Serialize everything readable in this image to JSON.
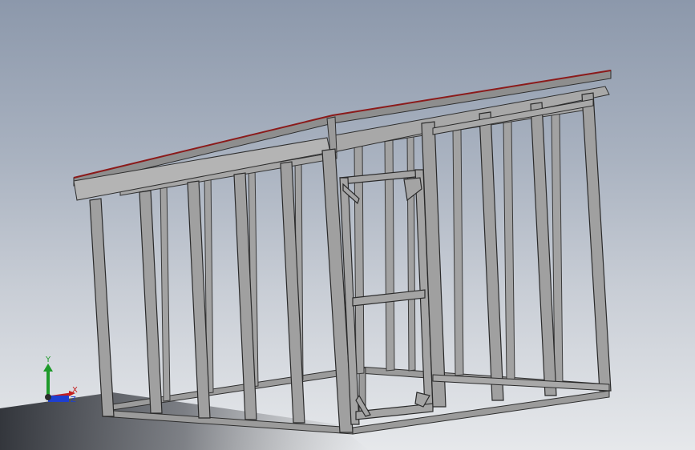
{
  "viewport": {
    "background_top": "#8c98ab",
    "background_bottom": "#e6e8eb"
  },
  "model": {
    "frame_color": "#9a9a9a",
    "frame_edge_color": "#3a3a3a",
    "roof_color": "#8f8f8f",
    "roof_edge_color": "#8b1a1a"
  },
  "triad": {
    "y_label": "Y",
    "x_label": "X",
    "z_label": "Z",
    "y_color": "#1e9a2a",
    "x_color": "#c41e1e",
    "z_color": "#1e3fd0"
  }
}
